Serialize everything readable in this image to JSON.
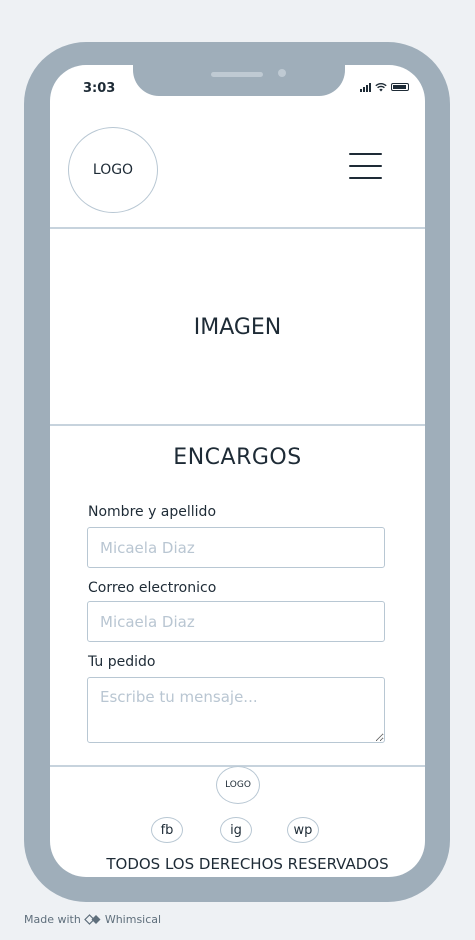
{
  "status_bar": {
    "time": "3:03"
  },
  "header": {
    "logo_label": "LOGO"
  },
  "hero": {
    "image_label": "IMAGEN"
  },
  "form": {
    "title": "ENCARGOS",
    "name_label": "Nombre y apellido",
    "name_placeholder": "Micaela Diaz",
    "email_label": "Correo electronico",
    "email_placeholder": "Micaela Diaz",
    "order_label": "Tu pedido",
    "order_placeholder": "Escribe tu mensaje..."
  },
  "footer": {
    "logo_label": "LOGO",
    "social": [
      "fb",
      "ig",
      "wp"
    ],
    "copyright": "TODOS LOS DERECHOS RESERVADOS"
  },
  "watermark": {
    "text": "Made with",
    "brand": "Whimsical"
  }
}
